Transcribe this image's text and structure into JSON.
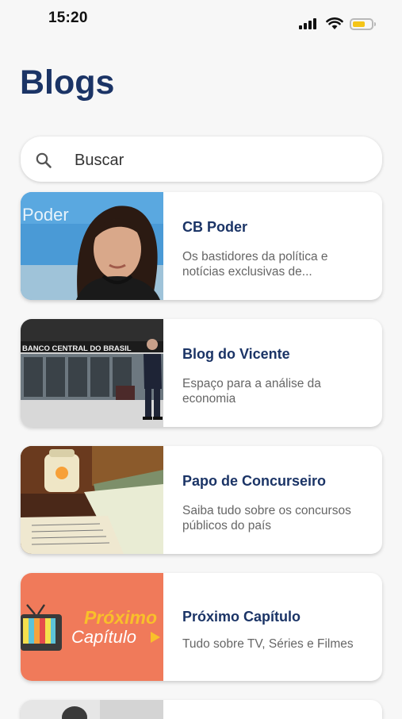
{
  "status_bar": {
    "time": "15:20",
    "battery_color": "#f5c518"
  },
  "page": {
    "title": "Blogs"
  },
  "search": {
    "placeholder": "Buscar",
    "icon": "search-icon"
  },
  "blogs": [
    {
      "title": "CB Poder",
      "description": "Os bastidores da política e notícias exclusivas de...",
      "thumb_text": "Poder"
    },
    {
      "title": "Blog do Vicente",
      "description": "Espaço para a análise da economia",
      "thumb_text": "BANCO CENTRAL DO BRASIL"
    },
    {
      "title": "Papo de Concurseiro",
      "description": "Saiba tudo sobre os concursos públicos do país"
    },
    {
      "title": "Próximo Capítulo",
      "description": "Tudo sobre TV, Séries e Filmes",
      "thumb_text_line1": "Próximo",
      "thumb_text_line2": "Capítulo"
    }
  ],
  "colors": {
    "title": "#1b3466",
    "background": "#f7f7f7",
    "card": "#ffffff",
    "accent_orange": "#f07a5a",
    "accent_yellow": "#f9c02a"
  }
}
